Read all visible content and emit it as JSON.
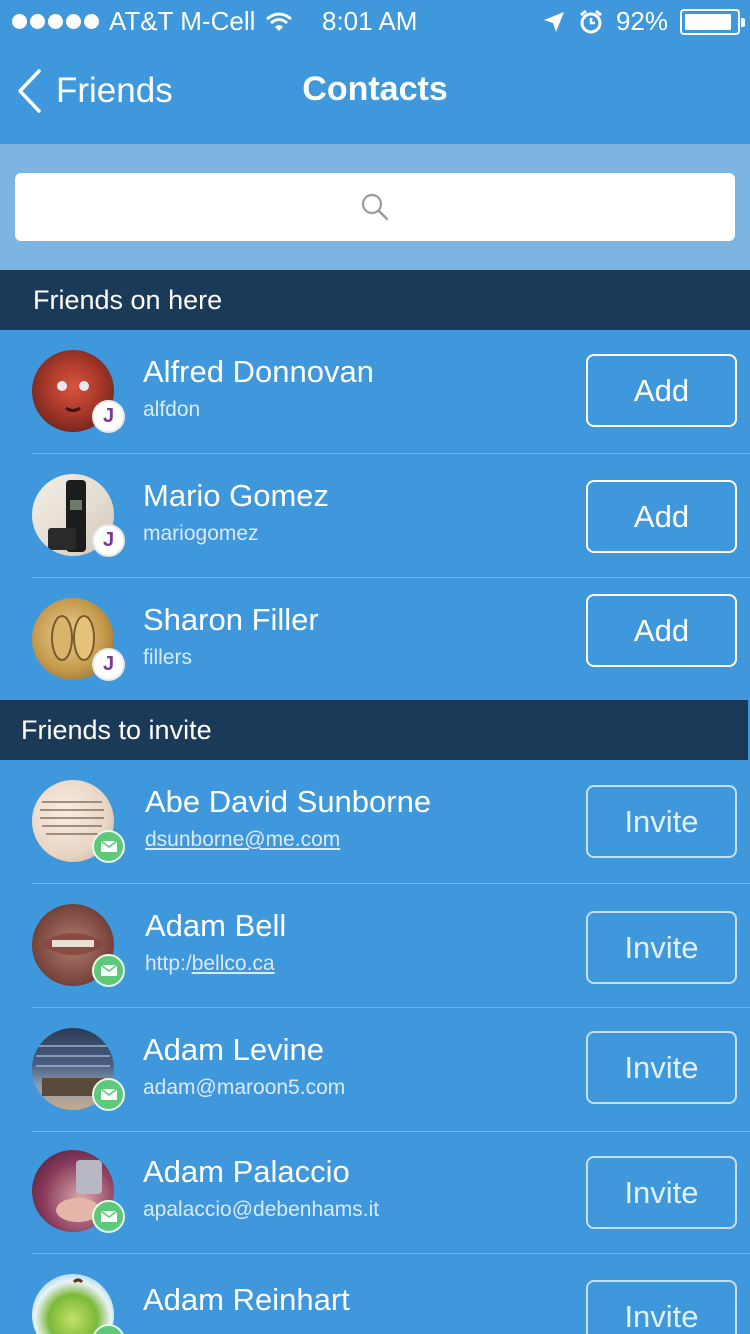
{
  "status_bar": {
    "carrier": "AT&T M-Cell",
    "time": "8:01 AM",
    "battery": "92%",
    "battery_level": 0.92
  },
  "nav": {
    "back_label": "Friends",
    "title": "Contacts"
  },
  "search": {
    "placeholder": ""
  },
  "friends_on_here": {
    "header": "Friends on here",
    "items": [
      {
        "name": "Alfred Donnovan",
        "username": "alfdon",
        "button": "Add"
      },
      {
        "name": "Mario Gomez",
        "username": "mariogomez",
        "button": "Add"
      },
      {
        "name": "Sharon Filler",
        "username": "fillers",
        "button": "Add"
      }
    ]
  },
  "friends_to_invite": {
    "header": "Friends to invite",
    "items": [
      {
        "name": "Abe David Sunborne",
        "contact": "dsunborne@me.com",
        "button": "Invite"
      },
      {
        "name": "Adam Bell",
        "contact_prefix": "http:/",
        "contact_link": "bellco.ca",
        "button": "Invite"
      },
      {
        "name": "Adam Levine",
        "contact": "adam@maroon5.com",
        "button": "Invite"
      },
      {
        "name": "Adam Palaccio",
        "contact": "apalaccio@debenhams.it",
        "button": "Invite"
      },
      {
        "name": "Adam Reinhart",
        "contact": "",
        "button": "Invite"
      }
    ]
  },
  "colors": {
    "background": "#3f97dc",
    "search_area": "#7db5e2",
    "section_header": "#1b3a58",
    "mail_badge": "#5fc97b",
    "app_badge": "#7a3a9a"
  }
}
